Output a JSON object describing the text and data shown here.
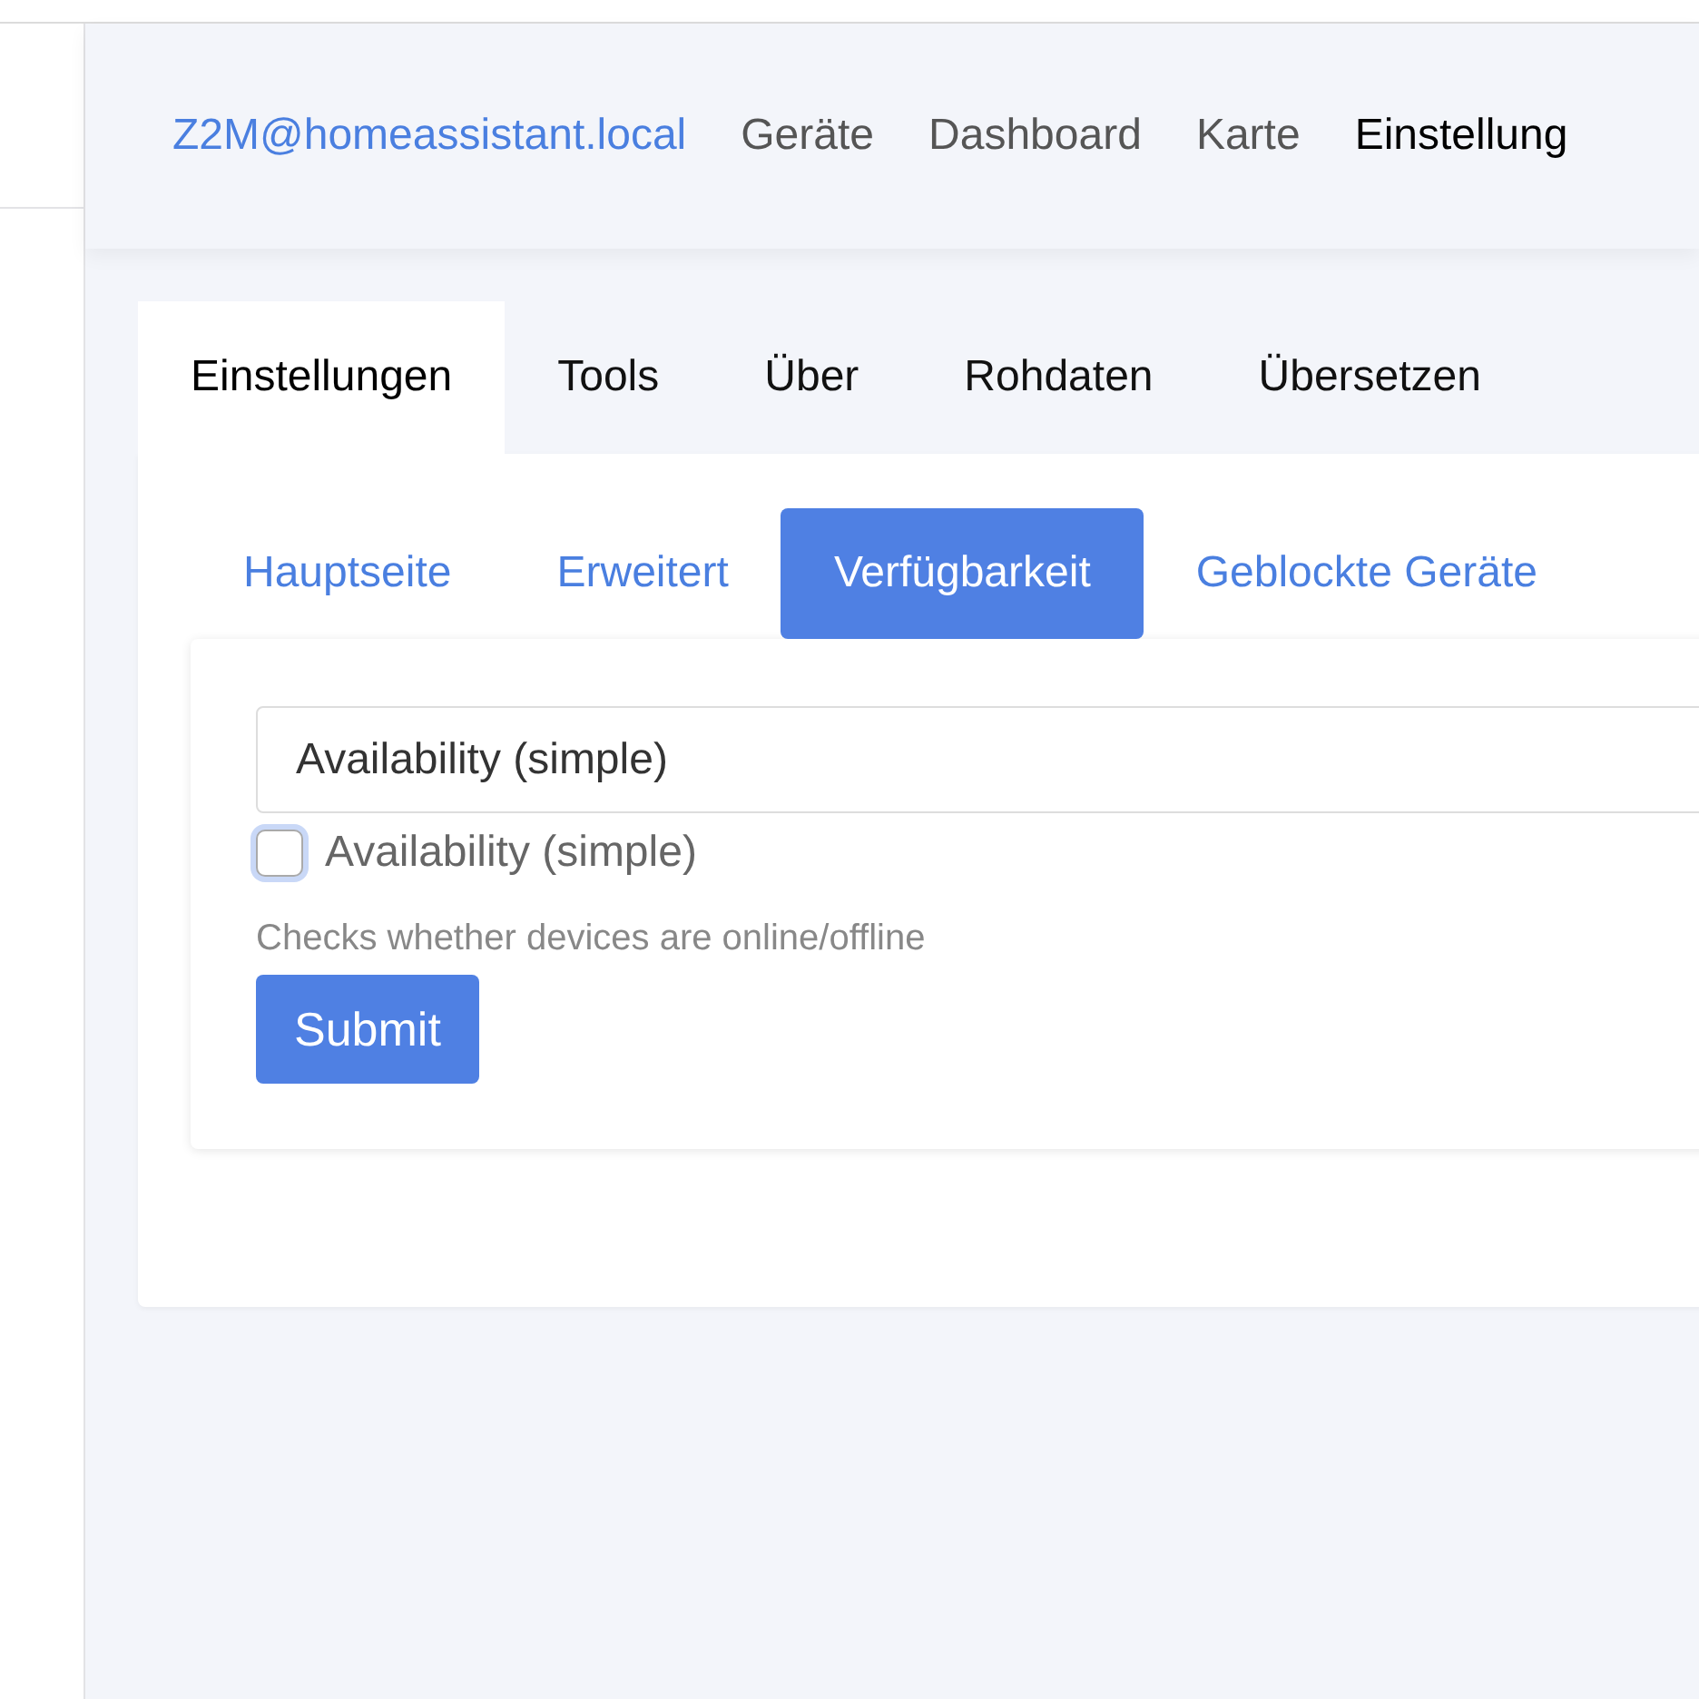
{
  "navbar": {
    "brand": "Z2M@homeassistant.local",
    "links": [
      {
        "label": "Geräte",
        "selected": false
      },
      {
        "label": "Dashboard",
        "selected": false
      },
      {
        "label": "Karte",
        "selected": false
      },
      {
        "label": "Einstellung",
        "selected": true
      }
    ]
  },
  "tabs": [
    {
      "label": "Einstellungen",
      "selected": true
    },
    {
      "label": "Tools",
      "selected": false
    },
    {
      "label": "Über",
      "selected": false
    },
    {
      "label": "Rohdaten",
      "selected": false
    },
    {
      "label": "Übersetzen",
      "selected": false
    }
  ],
  "subtabs": [
    {
      "label": "Hauptseite",
      "selected": false
    },
    {
      "label": "Erweitert",
      "selected": false
    },
    {
      "label": "Verfügbarkeit",
      "selected": true
    },
    {
      "label": "Geblockte Geräte",
      "selected": false
    }
  ],
  "form": {
    "select_value": "Availability (simple)",
    "checkbox": {
      "label": "Availability (simple)",
      "checked": false
    },
    "help": "Checks whether devices are online/offline",
    "submit": "Submit"
  }
}
